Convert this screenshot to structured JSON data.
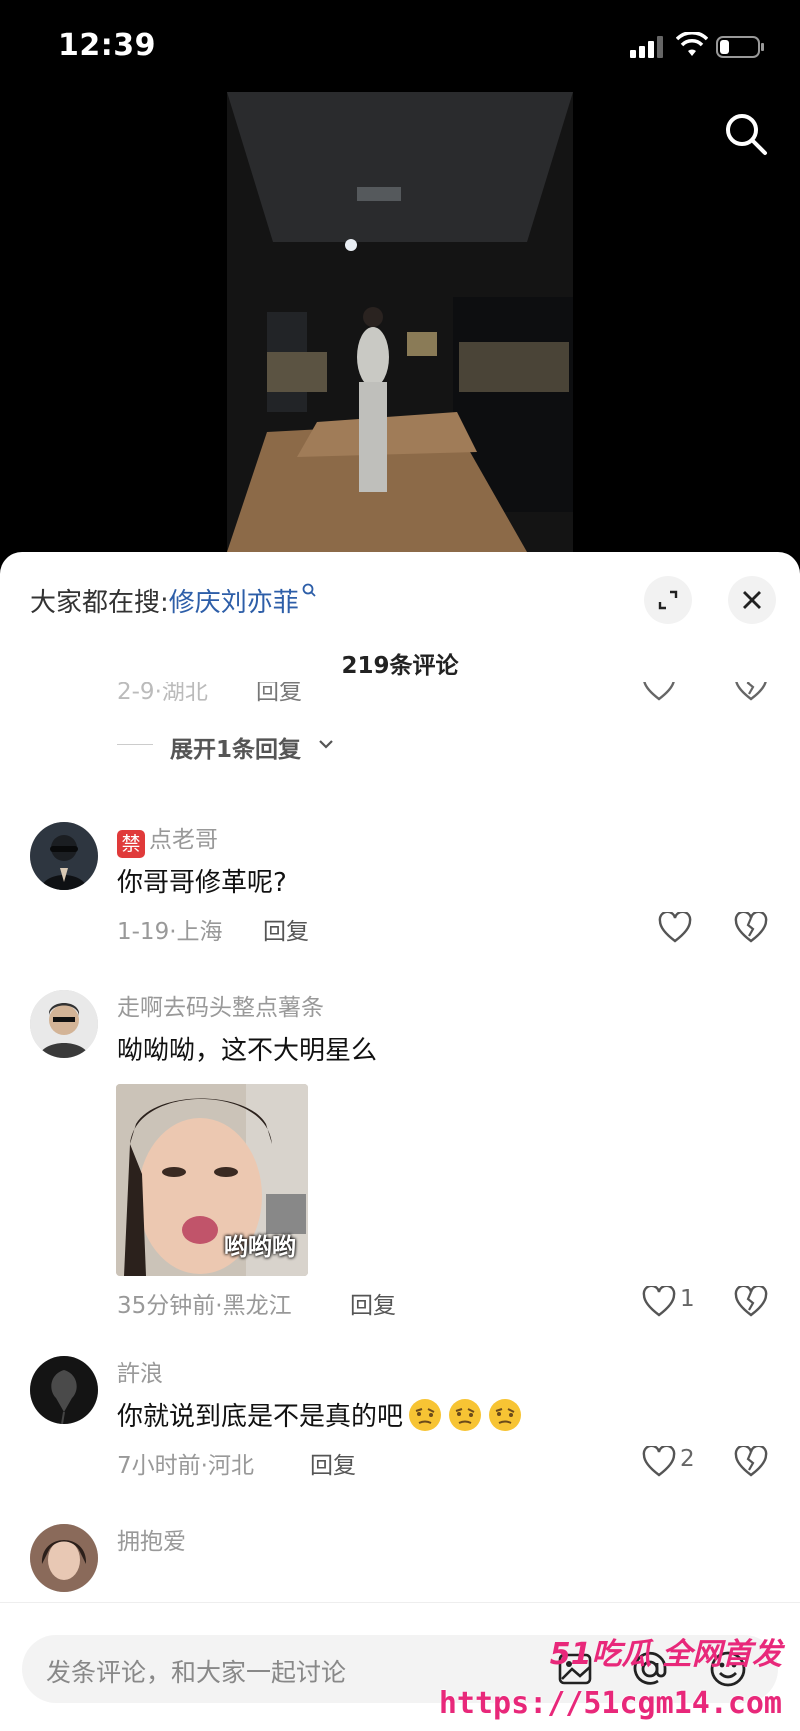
{
  "status": {
    "time": "12:39"
  },
  "sheet": {
    "hint_prefix": "大家都在搜:",
    "hint_keyword": "修庆刘亦菲",
    "comment_count": "219条评论"
  },
  "partial": {
    "meta": "2-9·湖北",
    "reply": "回复"
  },
  "expand": {
    "label": "展开1条回复"
  },
  "comments": [
    {
      "badge": "禁",
      "user": "点老哥",
      "text": "你哥哥修革呢?",
      "meta": "1-19·上海",
      "reply": "回复",
      "likes": ""
    },
    {
      "user": "走啊去码头整点薯条",
      "text": "呦呦呦，这不大明星么",
      "sticker_text": "哟哟哟",
      "meta": "35分钟前·黑龙江",
      "reply": "回复",
      "likes": "1"
    },
    {
      "user": "許浪",
      "text": "你就说到底是不是真的吧",
      "meta": "7小时前·河北",
      "reply": "回复",
      "likes": "2"
    },
    {
      "user": "拥抱爱"
    }
  ],
  "input": {
    "placeholder": "发条评论，和大家一起讨论"
  },
  "watermark": {
    "top": "51吃瓜 全网首发",
    "url": "https://51cgm14.com"
  },
  "icons": [
    "signal-icon",
    "wifi-icon",
    "battery-icon",
    "search-icon",
    "expand-icon",
    "close-icon",
    "heart-icon",
    "broken-heart-icon",
    "image-icon",
    "at-icon",
    "emoji-icon"
  ]
}
